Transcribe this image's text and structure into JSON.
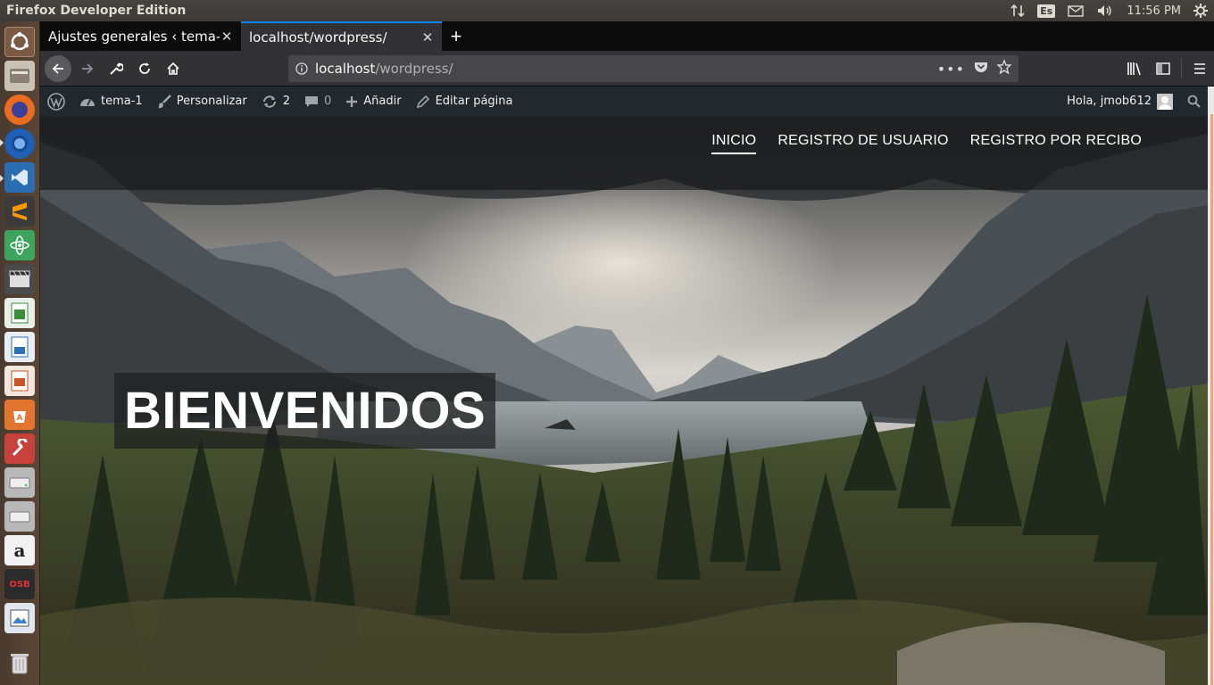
{
  "top_panel": {
    "app_title": "Firefox Developer Edition",
    "keyboard_layout": "Es",
    "clock": "11:56 PM"
  },
  "launcher": {
    "items": [
      "ubuntu-dash",
      "files",
      "firefox",
      "firefox-developer",
      "vscode",
      "sublime-text",
      "atom",
      "video-editor",
      "libreoffice-calc",
      "libreoffice-writer",
      "libreoffice-impress",
      "ubuntu-software",
      "system-settings",
      "disk-drive",
      "disk-drive-2",
      "amazon",
      "osb",
      "image-viewer",
      "trash"
    ]
  },
  "browser": {
    "tabs": [
      {
        "label": "Ajustes generales ‹ tema-1 —",
        "active": false
      },
      {
        "label": "localhost/wordpress/",
        "active": true
      }
    ],
    "url": {
      "host": "localhost",
      "path": "/wordpress/"
    }
  },
  "wp_admin_bar": {
    "site_name": "tema-1",
    "customize": "Personalizar",
    "updates_count": "2",
    "comments_count": "0",
    "add_new": "Añadir",
    "edit_page": "Editar página",
    "greeting": "Hola, jmob612"
  },
  "site": {
    "menu": [
      {
        "label": "INICIO",
        "current": true
      },
      {
        "label": "REGISTRO DE USUARIO",
        "current": false
      },
      {
        "label": "REGISTRO POR RECIBO",
        "current": false
      }
    ],
    "hero_title": "BIENVENIDOS"
  },
  "colors": {
    "tab_accent": "#0a84ff",
    "wp_bar": "#23282d",
    "panel": "#3c3b37"
  }
}
